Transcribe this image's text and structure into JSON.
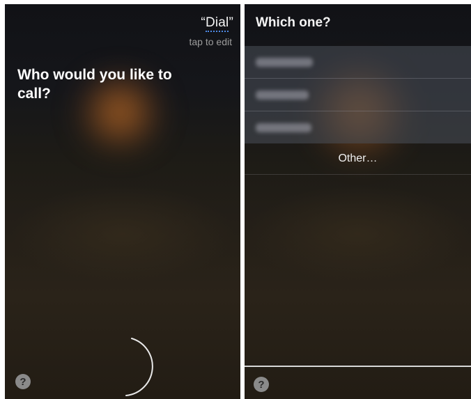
{
  "left_screen": {
    "heard_text": "Dial",
    "tap_to_edit": "tap to edit",
    "prompt": "Who would you like to call?",
    "help_label": "?"
  },
  "right_screen": {
    "title": "Which one?",
    "choices": [
      {
        "label": "",
        "blurred": true
      },
      {
        "label": "",
        "blurred": true
      },
      {
        "label": "",
        "blurred": true
      }
    ],
    "other_label": "Other…",
    "help_label": "?"
  },
  "colors": {
    "edit_underline": "#4f8be8",
    "glow": "#c87328",
    "help_button": "#8a8a8a"
  },
  "icons": [
    "question-mark-icon",
    "listening-arc-icon"
  ]
}
